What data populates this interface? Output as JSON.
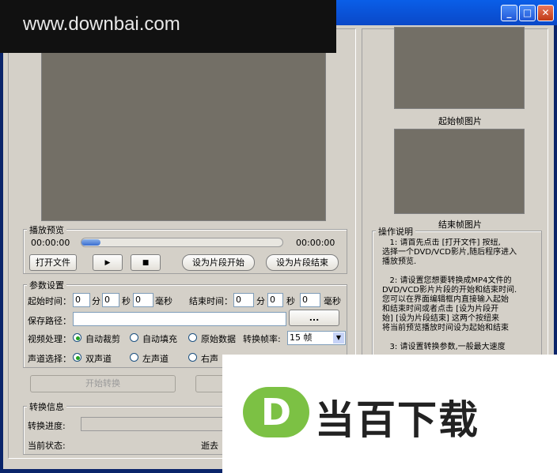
{
  "watermark": {
    "top_text": "www.downbai.com",
    "logo_letter": "D",
    "logo_text": "当百下载"
  },
  "titlebar": {
    "minimize": "_",
    "maximize": "□",
    "close": "✕"
  },
  "preview": {
    "group_title": "播放预览",
    "time_start": "00:00:00",
    "time_end": "00:00:00",
    "progress": 0.0,
    "open_file": "打开文件",
    "play": "▶",
    "stop": "■",
    "set_start": "设为片段开始",
    "set_end": "设为片段结束"
  },
  "frames": {
    "start_label": "起始帧图片",
    "end_label": "结束帧图片"
  },
  "params": {
    "group_title": "参数设置",
    "start_time_label": "起始时间：",
    "start_min": "0",
    "min_unit": "分",
    "start_sec": "0",
    "sec_unit": "秒",
    "start_ms": "0",
    "ms_unit": "毫秒",
    "end_time_label": "结束时间：",
    "end_min": "0",
    "end_sec": "0",
    "end_ms": "0",
    "save_path_label": "保存路径：",
    "save_path_value": "",
    "browse": "...",
    "video_label": "视频处理：",
    "video_options": [
      "自动裁剪",
      "自动填充",
      "原始数据"
    ],
    "video_selected": 0,
    "fps_label": "转换帧率:",
    "fps_value": "15  帧",
    "audio_label": "声道选择：",
    "audio_options": [
      "双声道",
      "左声道",
      "右声"
    ],
    "audio_selected": 0
  },
  "actions": {
    "start_convert": "开始转换"
  },
  "info": {
    "group_title": "转换信息",
    "progress_label": "转换进度:",
    "status_label": "当前状态:",
    "elapsed_label": "逝去"
  },
  "help": {
    "group_title": "操作说明",
    "text": "   1: 请首先点击 [打开文件] 按纽,\n选择一个DVD/VCD影片,随后程序进入\n播放预览.\n\n   2: 请设置您想要转换成MP4文件的\nDVD/VCD影片片段的开始和结束时间.\n您可以在界面编辑框内直接输入起始\n和结束时间或者点击 [设为片段开\n始] [设为片段结束] 这两个按纽来\n将当前预览播放时间设为起始和结束\n\n   3: 请设置转换参数,一般最大速度"
  },
  "colors": {
    "title_blue": "#0a54e0",
    "window_bg": "#d4d0c8",
    "video_bg": "#736f66",
    "logo_green": "#7cc144"
  }
}
